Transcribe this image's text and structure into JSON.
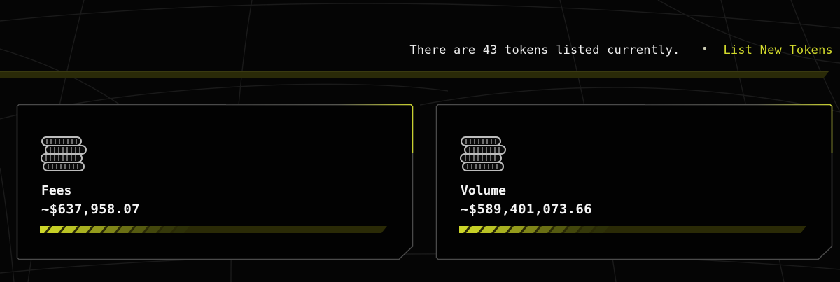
{
  "header": {
    "status_text": "There are 43 tokens listed currently.",
    "list_link_label": "List New Tokens"
  },
  "colors": {
    "accent": "#d4dc2c",
    "background": "#050505",
    "card_border": "#5a5a5a"
  },
  "stats": [
    {
      "label": "Fees",
      "value": "~$637,958.07",
      "icon": "coin-stack-icon",
      "progress_filled_segments": 10,
      "progress_total_segments": 10
    },
    {
      "label": "Volume",
      "value": "~$589,401,073.66",
      "icon": "coin-stack-icon",
      "progress_filled_segments": 10,
      "progress_total_segments": 10
    }
  ]
}
